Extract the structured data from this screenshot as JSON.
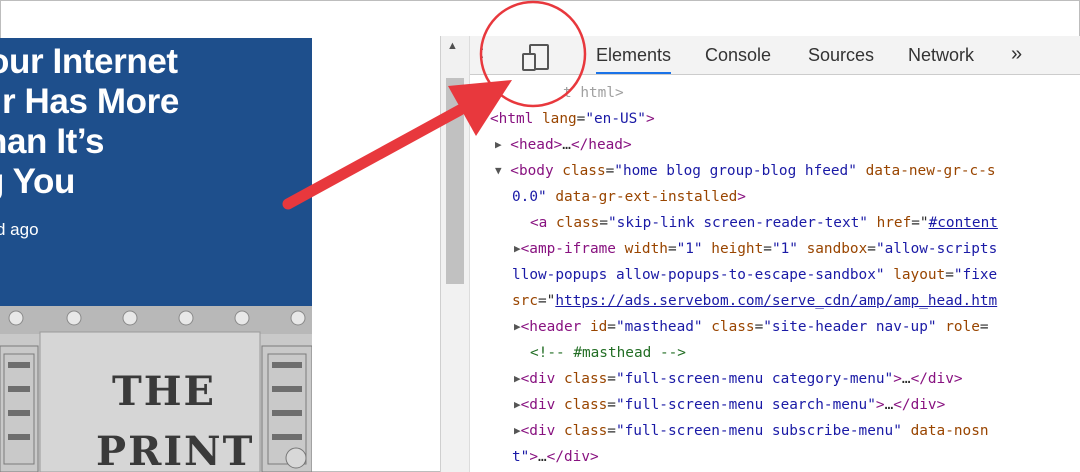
{
  "article": {
    "headline_lines": [
      "our Internet",
      "r Has More",
      "han It’s",
      "g You"
    ],
    "time_ago": "d ago",
    "image_text": [
      "THE",
      "PRINT"
    ]
  },
  "devtools": {
    "tabs": [
      "Elements",
      "Console",
      "Sources",
      "Network"
    ],
    "active_tab": "Elements",
    "more_label": "»",
    "doctype_fragment": "t html>",
    "lines": {
      "l1_tag": "html",
      "l1_attr": "lang",
      "l1_val": "\"en-US\"",
      "l2": "head",
      "l2_ellipsis": "…",
      "l3_tag": "body",
      "l3_attr1": "class",
      "l3_val1": "\"home blog group-blog hfeed\"",
      "l3_attr2": "data-new-gr-c-s",
      "l4_val": "0.0\"",
      "l4_attr": "data-gr-ext-installed",
      "l5_tag": "a",
      "l5_attr1": "class",
      "l5_val1": "\"skip-link screen-reader-text\"",
      "l5_attr2": "href",
      "l5_link": "#content",
      "l6_tag": "amp-iframe",
      "l6_attr1": "width",
      "l6_val1": "\"1\"",
      "l6_attr2": "height",
      "l6_val2": "\"1\"",
      "l6_attr3": "sandbox",
      "l6_val3": "\"allow-scripts",
      "l7_val": "llow-popups allow-popups-to-escape-sandbox\"",
      "l7_attr": "layout",
      "l7_val2": "\"fixe",
      "l8_attr": "src",
      "l8_link": "https://ads.servebom.com/serve_cdn/amp/amp_head.htm",
      "l9_tag": "header",
      "l9_attr1": "id",
      "l9_val1": "\"masthead\"",
      "l9_attr2": "class",
      "l9_val2": "\"site-header nav-up\"",
      "l9_attr3": "role",
      "l10_comment": "<!-- #masthead -->",
      "l11_tag": "div",
      "l11_attr": "class",
      "l11_val": "\"full-screen-menu category-menu\"",
      "l12_tag": "div",
      "l12_attr": "class",
      "l12_val": "\"full-screen-menu search-menu\"",
      "l13_tag": "div",
      "l13_attr": "class",
      "l13_val": "\"full-screen-menu subscribe-menu\"",
      "l13_attr2": "data-nosn",
      "l14_val": "t\"",
      "ellipsis": "…"
    }
  },
  "colors": {
    "article_bg": "#1e4f8c",
    "annotation": "#e8383d",
    "active_tab": "#1a73e8"
  },
  "icons": [
    "device-toolbar-icon",
    "more-tabs-icon",
    "scroll-up-icon",
    "expand-arrow-icon",
    "annotation-arrow"
  ]
}
